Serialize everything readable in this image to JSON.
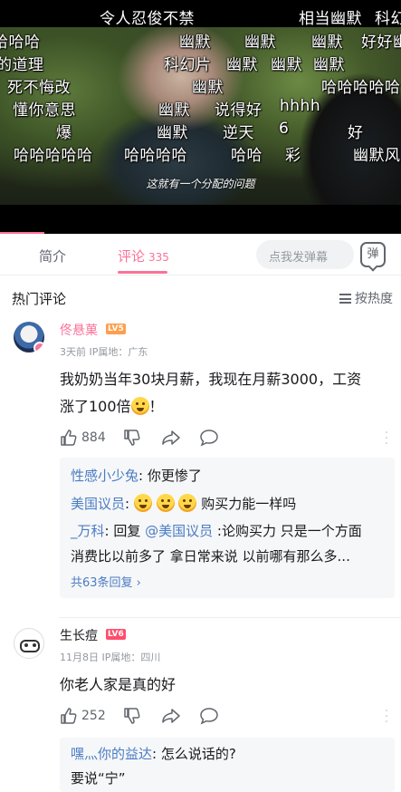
{
  "video": {
    "subtitle": "这就有一个分配的问题",
    "danmaku": [
      {
        "text": "令人忍俊不禁"
      },
      {
        "text": "相当幽默"
      },
      {
        "text": "科幻"
      },
      {
        "text": "哈哈哈"
      },
      {
        "text": "幽默"
      },
      {
        "text": "幽默"
      },
      {
        "text": "幽默"
      },
      {
        "text": "好好幽"
      },
      {
        "text": "的道理"
      },
      {
        "text": "科幻片"
      },
      {
        "text": "幽默"
      },
      {
        "text": "幽默"
      },
      {
        "text": "幽默"
      },
      {
        "text": "死不悔改"
      },
      {
        "text": "幽默"
      },
      {
        "text": "哈哈哈哈哈"
      },
      {
        "text": "懂你意思"
      },
      {
        "text": "幽默"
      },
      {
        "text": "说得好"
      },
      {
        "text": "hhhh"
      },
      {
        "text": "爆"
      },
      {
        "text": "幽默"
      },
      {
        "text": "逆天"
      },
      {
        "text": "6"
      },
      {
        "text": "好"
      },
      {
        "text": "哈哈哈哈哈"
      },
      {
        "text": "哈哈哈哈"
      },
      {
        "text": "哈哈"
      },
      {
        "text": "彩"
      },
      {
        "text": "幽默风"
      }
    ],
    "progress_fraction": 0.11,
    "colors": {
      "accent": "#fb7299"
    }
  },
  "tabs": {
    "intro_label": "简介",
    "comments_label": "评论",
    "comments_count": "335",
    "danmu_placeholder": "点我发弹幕",
    "danmu_button": "弹"
  },
  "comments_header": {
    "title": "热门评论",
    "sort_label": "按热度",
    "sort_icon": "lines-icon"
  },
  "comments": [
    {
      "user": "佟悬菓",
      "level": "LV5",
      "meta": "3天前  IP属地：广东",
      "line1": "我奶奶当年30块月薪，我现在月薪3000，工资",
      "line2": "涨了100倍",
      "line2_suffix": "！",
      "likes": "884",
      "replies": [
        {
          "name": "性感小少兔",
          "text": ": 你更惨了"
        },
        {
          "name": "美国议员",
          "text": ":",
          "tail": "购买力能一样吗"
        },
        {
          "name": "_万科",
          "text": ": 回复 ",
          "mention": "@美国议员",
          "tail": " :论购买力 只是一个方面"
        },
        {
          "line": "消费比以前多了  拿日常来说  以前哪有那么多..."
        }
      ],
      "more_replies": "共63条回复 ›"
    },
    {
      "user": "生长痘",
      "level": "LV6",
      "meta": "11月8日  IP属地：四川",
      "line1": "你老人家是真的好",
      "likes": "252",
      "replies": [
        {
          "name": "嘿灬你的益达",
          "text": ": 怎么说话的?"
        },
        {
          "line": "要说“宁”"
        }
      ]
    }
  ]
}
